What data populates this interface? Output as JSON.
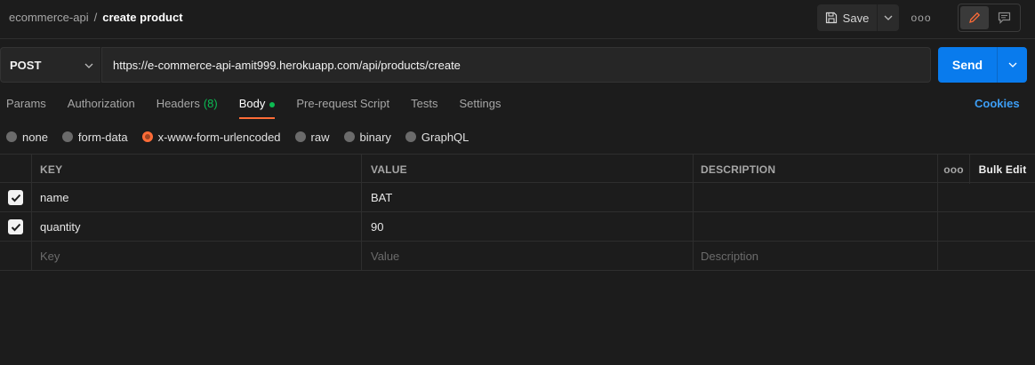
{
  "breadcrumb": {
    "collection": "ecommerce-api",
    "separator": "/",
    "request": "create product"
  },
  "header": {
    "save_label": "Save",
    "more_label": "ooo"
  },
  "request": {
    "method": "POST",
    "url": "https://e-commerce-api-amit999.herokuapp.com/api/products/create",
    "send_label": "Send"
  },
  "tabs": [
    {
      "label": "Params"
    },
    {
      "label": "Authorization"
    },
    {
      "label": "Headers",
      "count": "(8)"
    },
    {
      "label": "Body",
      "active": true
    },
    {
      "label": "Pre-request Script"
    },
    {
      "label": "Tests"
    },
    {
      "label": "Settings"
    }
  ],
  "cookies_label": "Cookies",
  "body_types": [
    {
      "label": "none"
    },
    {
      "label": "form-data"
    },
    {
      "label": "x-www-form-urlencoded",
      "selected": true
    },
    {
      "label": "raw"
    },
    {
      "label": "binary"
    },
    {
      "label": "GraphQL"
    }
  ],
  "table": {
    "headers": {
      "key": "KEY",
      "value": "VALUE",
      "description": "DESCRIPTION",
      "more": "ooo",
      "bulk_edit": "Bulk Edit"
    },
    "rows": [
      {
        "checked": true,
        "key": "name",
        "value": "BAT",
        "description": ""
      },
      {
        "checked": true,
        "key": "quantity",
        "value": "90",
        "description": ""
      }
    ],
    "placeholders": {
      "key": "Key",
      "value": "Value",
      "description": "Description"
    }
  },
  "colors": {
    "accent": "#ff6c37",
    "send": "#097bed",
    "link": "#3d9ef5",
    "success": "#0cbb52"
  }
}
